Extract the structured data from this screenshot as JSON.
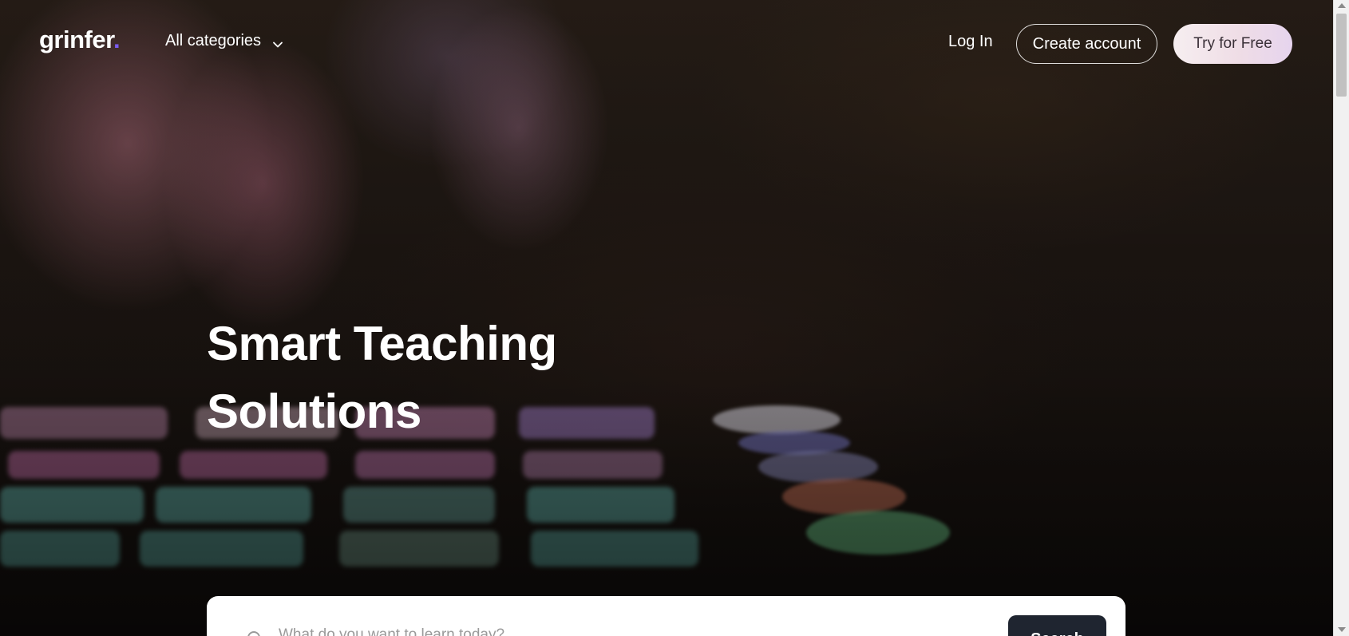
{
  "header": {
    "logo_text": "grinfer",
    "logo_dot": ".",
    "categories_label": "All categories",
    "login_label": "Log In",
    "create_account_label": "Create account",
    "try_free_label": "Try for Free"
  },
  "hero": {
    "title_line1": "Smart Teaching",
    "title_line2": "Solutions"
  },
  "search": {
    "placeholder": "What do you want to learn today?",
    "button_label": "Search"
  },
  "icons": {
    "categories_toggle": "chevron-down-icon",
    "search": "search-icon"
  },
  "colors": {
    "logo_accent": "#7b5cf0",
    "search_button": "#1f2530",
    "try_free_bg": "#efdde6"
  }
}
